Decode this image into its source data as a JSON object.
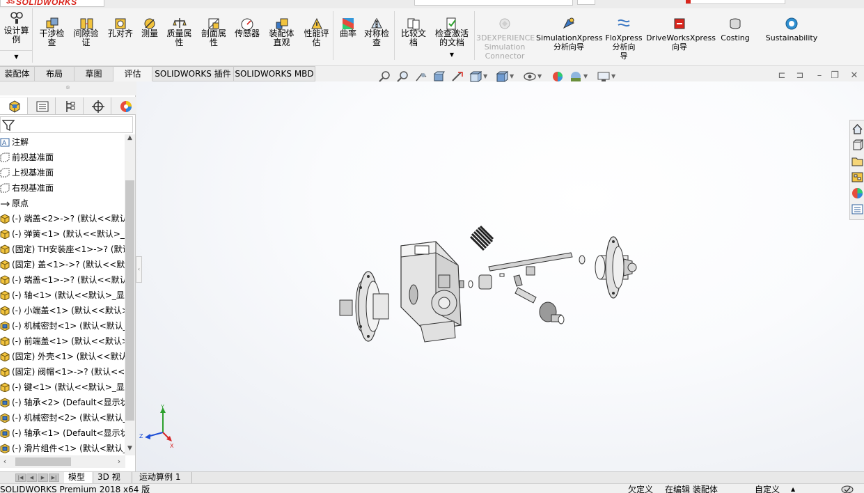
{
  "app": {
    "logo_text": "SOLIDWORKS"
  },
  "command_manager": {
    "design_study_label": "设计算\n例",
    "buttons": [
      {
        "id": "interference",
        "label": "干涉检\n查",
        "icon": "interference-icon"
      },
      {
        "id": "clearance",
        "label": "间隙验\n证",
        "icon": "clearance-icon"
      },
      {
        "id": "hole-alignment",
        "label": "孔对齐",
        "icon": "hole-alignment-icon"
      },
      {
        "id": "measure",
        "label": "测量",
        "icon": "measure-icon"
      },
      {
        "id": "mass-properties",
        "label": "质量属\n性",
        "icon": "mass-properties-icon"
      },
      {
        "id": "section-properties",
        "label": "剖面属\n性",
        "icon": "section-properties-icon"
      },
      {
        "id": "sensor",
        "label": "传感器",
        "icon": "sensor-icon"
      },
      {
        "id": "assembly-visualization",
        "label": "装配体\n直观",
        "icon": "assembly-visualization-icon"
      },
      {
        "id": "performance-evaluation",
        "label": "性能评\n估",
        "icon": "performance-evaluation-icon"
      },
      {
        "id": "curvature",
        "label": "曲率",
        "icon": "curvature-icon"
      },
      {
        "id": "symmetry-check",
        "label": "对称检\n查",
        "icon": "symmetry-check-icon"
      },
      {
        "id": "compare-documents",
        "label": "比较文\n档",
        "icon": "compare-documents-icon"
      },
      {
        "id": "check-active-document",
        "label": "检查激活\n的文档",
        "icon": "check-document-icon"
      },
      {
        "id": "3dx-simulation-connector",
        "label": "3DEXPERIENCE\nSimulation\nConnector",
        "icon": "3dexperience-icon"
      },
      {
        "id": "simulationxpress",
        "label": "SimulationXpress\n分析向导",
        "icon": "simulationxpress-icon"
      },
      {
        "id": "floxpress",
        "label": "FloXpress\n分析向\n导",
        "icon": "floxpress-icon"
      },
      {
        "id": "driveworksxpress",
        "label": "DriveWorksXpress\n向导",
        "icon": "driveworksxpress-icon"
      },
      {
        "id": "costing",
        "label": "Costing",
        "icon": "costing-icon"
      },
      {
        "id": "sustainability",
        "label": "Sustainability",
        "icon": "sustainability-icon"
      }
    ],
    "tabs": [
      "装配体",
      "布局",
      "草图",
      "评估",
      "SOLIDWORKS 插件",
      "SOLIDWORKS MBD"
    ],
    "active_tab": "评估"
  },
  "feature_manager": {
    "handle_glyph": "⌾",
    "tree": [
      {
        "label": "注解",
        "icon": "annotations-icon"
      },
      {
        "label": "前视基准面",
        "icon": "plane-icon"
      },
      {
        "label": "上视基准面",
        "icon": "plane-icon"
      },
      {
        "label": "右视基准面",
        "icon": "plane-icon"
      },
      {
        "label": "原点",
        "icon": "origin-icon"
      },
      {
        "label": "(-) 端盖<2>->? (默认<<默认",
        "icon": "part-icon"
      },
      {
        "label": "(-) 弹簧<1> (默认<<默认>_显",
        "icon": "part-icon"
      },
      {
        "label": "(固定) TH安装座<1>->? (默认",
        "icon": "part-icon"
      },
      {
        "label": "(固定) 盖<1>->? (默认<<默认",
        "icon": "part-icon"
      },
      {
        "label": "(-) 端盖<1>->? (默认<<默认>",
        "icon": "part-icon"
      },
      {
        "label": "(-) 轴<1> (默认<<默认>_显示",
        "icon": "part-icon"
      },
      {
        "label": "(-) 小端盖<1> (默认<<默认>",
        "icon": "part-icon"
      },
      {
        "label": "(-) 机械密封<1> (默认<默认_",
        "icon": "subassembly-icon"
      },
      {
        "label": "(-) 前端盖<1> (默认<<默认>",
        "icon": "part-icon"
      },
      {
        "label": "(固定) 外壳<1> (默认<<默认",
        "icon": "part-icon"
      },
      {
        "label": "(固定) 阀帽<1>->? (默认<<默",
        "icon": "part-icon"
      },
      {
        "label": "(-) 键<1> (默认<<默认>_显示",
        "icon": "part-icon"
      },
      {
        "label": "(-) 轴承<2> (Default<显示状",
        "icon": "subassembly-icon"
      },
      {
        "label": "(-) 机械密封<2> (默认<默认_",
        "icon": "subassembly-icon"
      },
      {
        "label": "(-) 轴承<1> (Default<显示状",
        "icon": "subassembly-icon"
      },
      {
        "label": "(-) 滑片组件<1> (默认<默认_",
        "icon": "subassembly-icon"
      }
    ]
  },
  "triad": {
    "x_label": "X",
    "y_label": "Y",
    "z_label": "Z"
  },
  "model_tabs": [
    "模型",
    "3D 视图",
    "运动算例 1"
  ],
  "active_model_tab": "模型",
  "status_bar": {
    "product": "SOLIDWORKS Premium 2018 x64 版",
    "defined": "欠定义",
    "mode": "在编辑 装配体",
    "units": "自定义",
    "units_arrow": "▲"
  },
  "colors": {
    "brand_red": "#d9251c",
    "graphics_bg_center": "#ffffff",
    "graphics_bg_edge": "#e9ecf2"
  }
}
